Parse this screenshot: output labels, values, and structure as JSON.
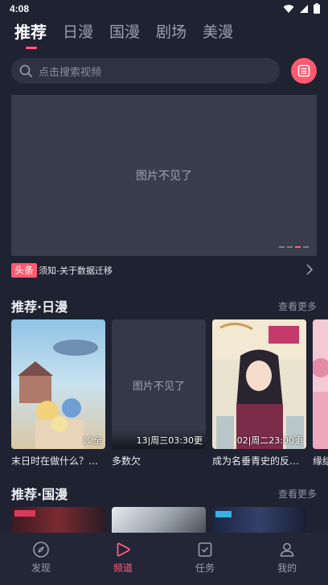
{
  "status": {
    "time": "4:08"
  },
  "tabs": [
    {
      "label": "推荐"
    },
    {
      "label": "日漫"
    },
    {
      "label": "国漫"
    },
    {
      "label": "剧场"
    },
    {
      "label": "美漫"
    }
  ],
  "search": {
    "placeholder": "点击搜索视频"
  },
  "banner": {
    "missing_text": "图片不见了"
  },
  "notice": {
    "tag": "头条",
    "text": "须知-关于数据迁移"
  },
  "section_japan": {
    "title": "推荐·日漫",
    "more": "查看更多"
  },
  "japan_cards": [
    {
      "name": "末日时在做什么？…",
      "ep": "12全"
    },
    {
      "name": "多数欠",
      "ep": "13|周三03:30更",
      "missing_text": "图片不见了"
    },
    {
      "name": "成为名垂青史的反…",
      "ep": "02|周二23:00更"
    },
    {
      "name": "缘结",
      "ep": ""
    }
  ],
  "section_china": {
    "title": "推荐·国漫",
    "more": "查看更多"
  },
  "nav": [
    {
      "label": "发现"
    },
    {
      "label": "频道"
    },
    {
      "label": "任务"
    },
    {
      "label": "我的"
    }
  ],
  "colors": {
    "accent": "#ff5c7c",
    "background": "#1f2231"
  }
}
